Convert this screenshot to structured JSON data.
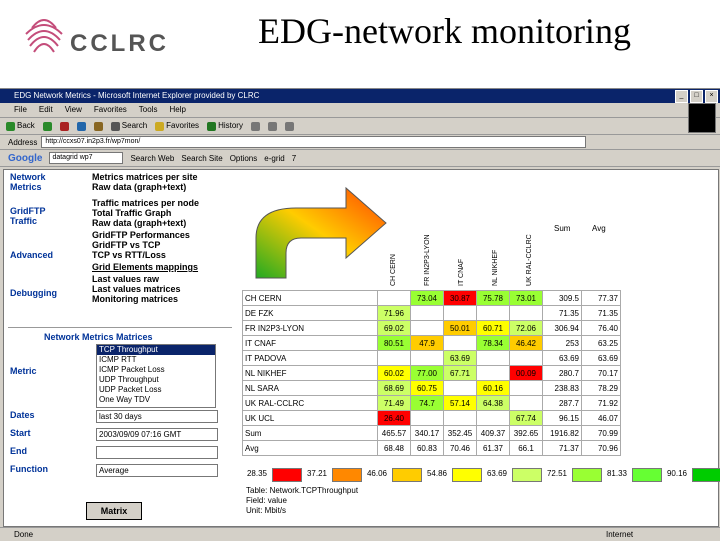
{
  "slide": {
    "logo_text": "CCLRC",
    "title": "EDG-network monitoring"
  },
  "browser": {
    "title": "EDG Network Metrics - Microsoft Internet Explorer provided by CLRC",
    "menu": [
      "File",
      "Edit",
      "View",
      "Favorites",
      "Tools",
      "Help"
    ],
    "toolbar": [
      "Back",
      "Search",
      "Favorites",
      "History"
    ],
    "address_label": "Address",
    "address": "http://ccxs07.in2p3.fr/wp7mon/",
    "google": {
      "logo": "Google",
      "query": "datagrid wp7",
      "buttons": [
        "Search Web",
        "Search Site",
        "Options",
        "e-grid",
        "7"
      ]
    },
    "status": "Done",
    "zone": "Internet"
  },
  "nav": {
    "sections": [
      {
        "label1": "Network",
        "label2": "Metrics",
        "links": [
          "Metrics matrices per site",
          "Raw data (graph+text)"
        ]
      },
      {
        "label1": "GridFTP",
        "label2": "Traffic",
        "links": [
          "Traffic matrices per node",
          "Total Traffic Graph",
          "Raw data (graph+text)"
        ]
      },
      {
        "label1": "Advanced",
        "label2": "",
        "links": [
          "GridFTP Performances",
          "GridFTP vs TCP",
          "TCP vs RTT/Loss",
          "Grid Elements mappings"
        ]
      },
      {
        "label1": "Debugging",
        "label2": "",
        "links": [
          "Last values raw",
          "Last values matrices",
          "Monitoring matrices"
        ]
      }
    ],
    "matrices_title": "Network Metrics Matrices",
    "metric_label": "Metric",
    "metrics": [
      "TCP Throughput",
      "ICMP RTT",
      "ICMP Packet Loss",
      "UDP Throughput",
      "UDP Packet Loss",
      "One Way TDV"
    ],
    "dates_label": "Dates",
    "dates_value": "last 30 days",
    "start_label": "Start",
    "start_value": "2003/09/09 07:16 GMT",
    "end_label": "End",
    "end_value": "",
    "function_label": "Function",
    "function_value": "Average",
    "matrix_button": "Matrix"
  },
  "matrix": {
    "columns": [
      "CH CERN",
      "FR IN2P3-LYON",
      "IT CNAF",
      "NL NIKHEF",
      "UK RAL-CCLRC"
    ],
    "sum_label": "Sum",
    "avg_label": "Avg",
    "rows": [
      {
        "name": "CH CERN",
        "cells": [
          "",
          "73.04",
          "30.87",
          "75.78",
          "73.01"
        ],
        "sum": "309.5",
        "avg": "77.37"
      },
      {
        "name": "DE FZK",
        "cells": [
          "71.96",
          "",
          "",
          "",
          ""
        ],
        "sum": "71.35",
        "avg": "71.35"
      },
      {
        "name": "FR IN2P3-LYON",
        "cells": [
          "69.02",
          "",
          "50.01",
          "60.71",
          "72.06"
        ],
        "sum": "306.94",
        "avg": "76.40"
      },
      {
        "name": "IT CNAF",
        "cells": [
          "80.51",
          "47.9",
          "",
          "78.34",
          "46.42"
        ],
        "sum": "253",
        "avg": "63.25"
      },
      {
        "name": "IT PADOVA",
        "cells": [
          "",
          "",
          "63.69",
          "",
          ""
        ],
        "sum": "63.69",
        "avg": "63.69"
      },
      {
        "name": "NL NIKHEF",
        "cells": [
          "60.02",
          "77.00",
          "67.71",
          "",
          "00.09"
        ],
        "sum": "280.7",
        "avg": "70.17"
      },
      {
        "name": "NL SARA",
        "cells": [
          "68.69",
          "60.75",
          "",
          "60.16",
          ""
        ],
        "sum": "238.83",
        "avg": "78.29"
      },
      {
        "name": "UK RAL-CCLRC",
        "cells": [
          "71.49",
          "74.7",
          "57.14",
          "64.38",
          ""
        ],
        "sum": "287.7",
        "avg": "71.92"
      },
      {
        "name": "UK UCL",
        "cells": [
          "26.40",
          "",
          "",
          "",
          "67.74"
        ],
        "sum": "96.15",
        "avg": "46.07"
      }
    ],
    "sum_row": {
      "name": "Sum",
      "cells": [
        "465.57",
        "340.17",
        "352.45",
        "409.37",
        "392.65"
      ],
      "sum": "1916.82",
      "avg": "70.99"
    },
    "avg_row": {
      "name": "Avg",
      "cells": [
        "68.48",
        "60.83",
        "70.46",
        "61.37",
        "66.1"
      ],
      "sum": "71.37",
      "avg": "70.96"
    }
  },
  "legend": {
    "values": [
      "28.35",
      "37.21",
      "46.06",
      "54.86",
      "63.69",
      "72.51",
      "81.33",
      "90.16"
    ],
    "colors": [
      "#ff0000",
      "#ff8800",
      "#ffcc00",
      "#ffff00",
      "#ccff66",
      "#99ff33",
      "#66ff33",
      "#00cc00"
    ]
  },
  "info": {
    "line1": "Table: Network.TCPThroughput",
    "line2": "Field: value",
    "line3": "Unit: Mbit/s"
  }
}
